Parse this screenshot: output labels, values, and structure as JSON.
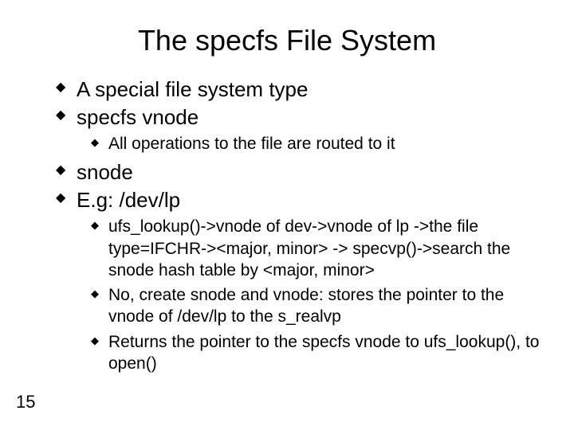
{
  "title": "The specfs File System",
  "bullets": {
    "b1": "A special file system type",
    "b2": " specfs vnode",
    "b2_sub1": "All operations to the file are routed to it",
    "b3": " snode",
    "b4": "E.g: /dev/lp",
    "b4_sub1": "ufs_lookup()->vnode of dev->vnode of lp ->the file type=IFCHR-><major, minor> -> specvp()->search the snode hash table by <major, minor>",
    "b4_sub2": "No, create snode and vnode: stores the pointer to the vnode of /dev/lp to the s_realvp",
    "b4_sub3": "Returns the pointer to the specfs vnode to ufs_lookup(), to open()"
  },
  "page_number": "15"
}
